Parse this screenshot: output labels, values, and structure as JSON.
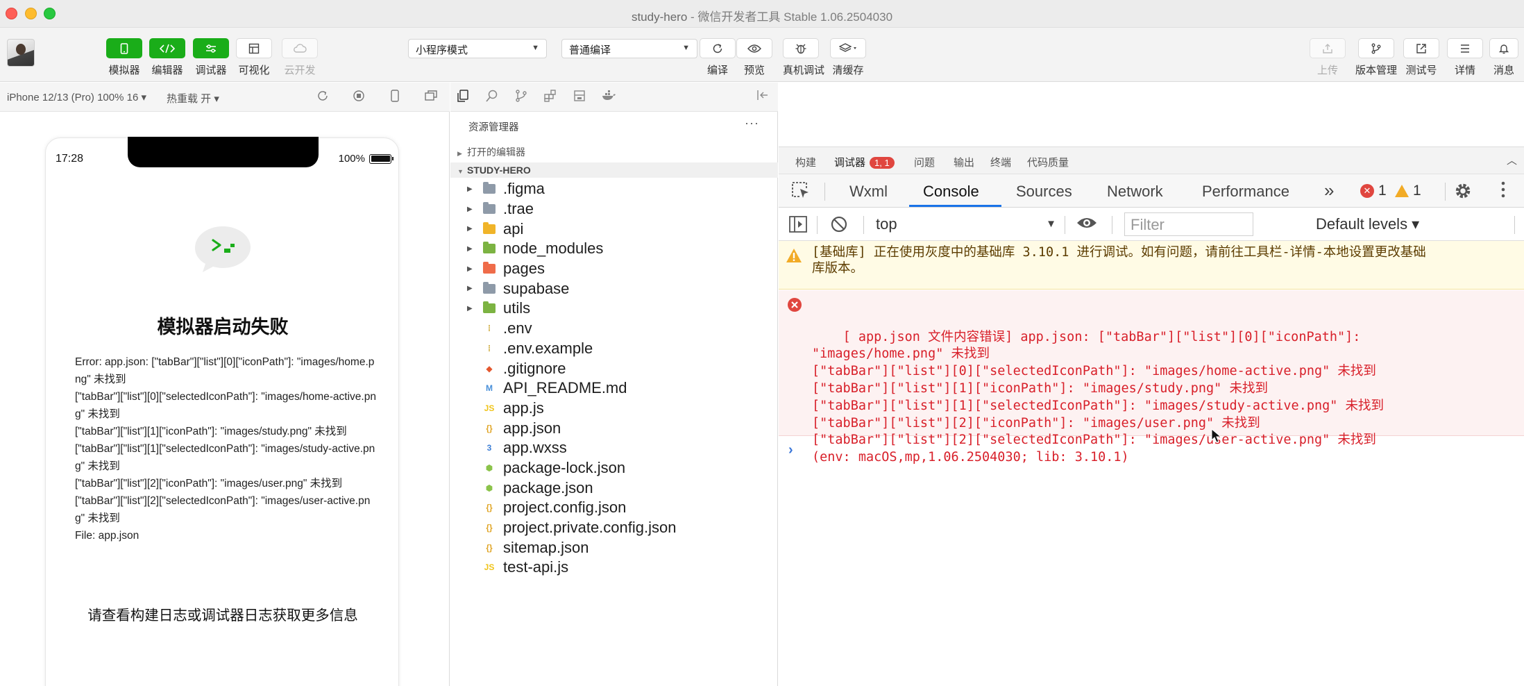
{
  "window": {
    "title_main": "study-hero",
    "title_sep": " - ",
    "title_sub": "微信开发者工具 Stable 1.06.2504030"
  },
  "toolbar": {
    "simulator": "模拟器",
    "editor": "编辑器",
    "debugger": "调试器",
    "visual": "可视化",
    "cloud": "云开发",
    "mode_select": "小程序模式",
    "compile_select": "普通编译",
    "compile": "编译",
    "preview": "预览",
    "real_debug": "真机调试",
    "clear_cache": "清缓存",
    "upload": "上传",
    "version": "版本管理",
    "test_account": "测试号",
    "details": "详情",
    "messages": "消息"
  },
  "simulator": {
    "device": "iPhone 12/13 (Pro) 100% 16 ▾",
    "hot_reload": "热重载 开 ▾",
    "time": "17:28",
    "battery": "100%",
    "error_title": "模拟器启动失败",
    "error_lines": [
      "Error: app.json: [\"tabBar\"][\"list\"][0][\"iconPath\"]: \"images/home.png\" 未找到",
      "[\"tabBar\"][\"list\"][0][\"selectedIconPath\"]: \"images/home-active.png\" 未找到",
      "[\"tabBar\"][\"list\"][1][\"iconPath\"]: \"images/study.png\" 未找到",
      "[\"tabBar\"][\"list\"][1][\"selectedIconPath\"]: \"images/study-active.png\" 未找到",
      "[\"tabBar\"][\"list\"][2][\"iconPath\"]: \"images/user.png\" 未找到",
      "[\"tabBar\"][\"list\"][2][\"selectedIconPath\"]: \"images/user-active.png\" 未找到",
      "File: app.json"
    ],
    "hint": "请查看构建日志或调试器日志获取更多信息"
  },
  "explorer": {
    "title": "资源管理器",
    "more": "···",
    "open_editors": "打开的编辑器",
    "project": "STUDY-HERO",
    "items": [
      {
        "name": ".figma",
        "type": "folder",
        "color": "#8e9aa8"
      },
      {
        "name": ".trae",
        "type": "folder",
        "color": "#8e9aa8"
      },
      {
        "name": "api",
        "type": "folder",
        "color": "#f0b429"
      },
      {
        "name": "node_modules",
        "type": "folder",
        "color": "#7cb342"
      },
      {
        "name": "pages",
        "type": "folder",
        "color": "#ef6c4a"
      },
      {
        "name": "supabase",
        "type": "folder",
        "color": "#8e9aa8"
      },
      {
        "name": "utils",
        "type": "folder",
        "color": "#7cb342"
      },
      {
        "name": ".env",
        "type": "file",
        "glyph": "⁞",
        "color": "#c9a227"
      },
      {
        "name": ".env.example",
        "type": "file",
        "glyph": "⁞",
        "color": "#c9a227"
      },
      {
        "name": ".gitignore",
        "type": "file",
        "glyph": "◆",
        "color": "#e4572e"
      },
      {
        "name": "API_README.md",
        "type": "file",
        "glyph": "M",
        "color": "#4a90d9"
      },
      {
        "name": "app.js",
        "type": "file",
        "glyph": "JS",
        "color": "#f0c419"
      },
      {
        "name": "app.json",
        "type": "file",
        "glyph": "{}",
        "color": "#e0a526"
      },
      {
        "name": "app.wxss",
        "type": "file",
        "glyph": "3",
        "color": "#3d7fd6"
      },
      {
        "name": "package-lock.json",
        "type": "file",
        "glyph": "⬢",
        "color": "#8bc34a"
      },
      {
        "name": "package.json",
        "type": "file",
        "glyph": "⬢",
        "color": "#8bc34a"
      },
      {
        "name": "project.config.json",
        "type": "file",
        "glyph": "{}",
        "color": "#e0a526"
      },
      {
        "name": "project.private.config.json",
        "type": "file",
        "glyph": "{}",
        "color": "#e0a526"
      },
      {
        "name": "sitemap.json",
        "type": "file",
        "glyph": "{}",
        "color": "#e0a526"
      },
      {
        "name": "test-api.js",
        "type": "file",
        "glyph": "JS",
        "color": "#f0c419"
      }
    ]
  },
  "panel_tabs": {
    "build": "构建",
    "debugger": "调试器",
    "debugger_badge": "1, 1",
    "problems": "问题",
    "output": "输出",
    "terminal": "终端",
    "quality": "代码质量",
    "collapse": "︿"
  },
  "devtools": {
    "wxml": "Wxml",
    "console": "Console",
    "sources": "Sources",
    "network": "Network",
    "performance": "Performance",
    "more": "»",
    "error_count": "1",
    "warn_count": "1",
    "context": "top",
    "filter_placeholder": "Filter",
    "levels": "Default levels ▾"
  },
  "console": {
    "warning_line1": "[基础库] 正在使用灰度中的基础库 3.10.1 进行调试。如有问题，请前往工具栏-详情-本地设置更改基础",
    "warning_line2": "库版本。",
    "error_text": "[ app.json 文件内容错误] app.json: [\"tabBar\"][\"list\"][0][\"iconPath\"]:\n\"images/home.png\" 未找到\n[\"tabBar\"][\"list\"][0][\"selectedIconPath\"]: \"images/home-active.png\" 未找到\n[\"tabBar\"][\"list\"][1][\"iconPath\"]: \"images/study.png\" 未找到\n[\"tabBar\"][\"list\"][1][\"selectedIconPath\"]: \"images/study-active.png\" 未找到\n[\"tabBar\"][\"list\"][2][\"iconPath\"]: \"images/user.png\" 未找到\n[\"tabBar\"][\"list\"][2][\"selectedIconPath\"]: \"images/user-active.png\" 未找到\n(env: macOS,mp,1.06.2504030; lib: 3.10.1)",
    "prompt": "›"
  }
}
